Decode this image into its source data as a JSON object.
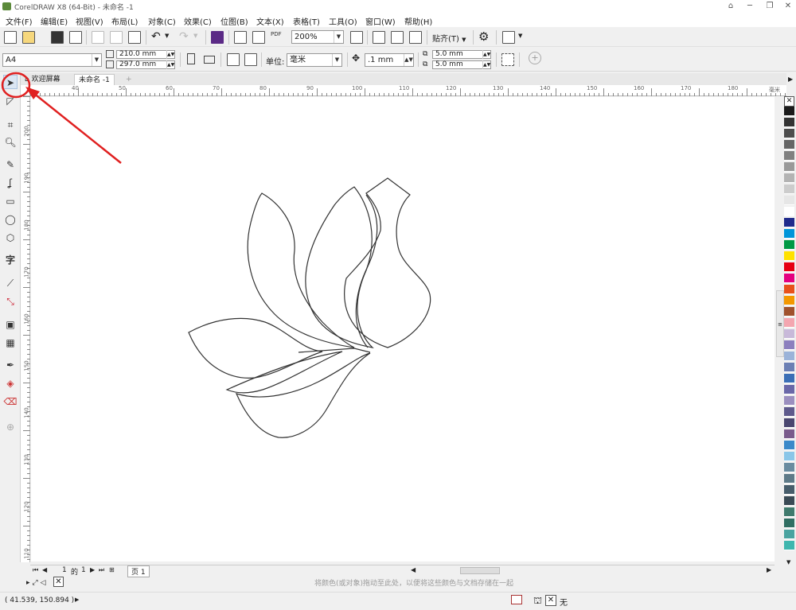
{
  "window": {
    "title": "CorelDRAW X8 (64-Bit) - 未命名 -1"
  },
  "menu": [
    "文件(F)",
    "编辑(E)",
    "视图(V)",
    "布局(L)",
    "对象(C)",
    "效果(C)",
    "位图(B)",
    "文本(X)",
    "表格(T)",
    "工具(O)",
    "窗口(W)",
    "帮助(H)"
  ],
  "toolbar": {
    "zoom": "200%",
    "snap_label": "贴齐(T)",
    "pdf_label": "PDF"
  },
  "property": {
    "page_size": "A4",
    "width": "210.0 mm",
    "height": "297.0 mm",
    "unit_label": "单位:",
    "unit_value": "毫米",
    "nudge": ".1 mm",
    "dup_x": "5.0 mm",
    "dup_y": "5.0 mm"
  },
  "tabs": {
    "welcome": "欢迎屏幕",
    "doc": "未命名 -1"
  },
  "ruler": {
    "h_labels": [
      "40",
      "50",
      "60",
      "70",
      "80",
      "90",
      "100",
      "110",
      "120",
      "130",
      "140",
      "150",
      "160",
      "170",
      "180"
    ],
    "unit": "毫米",
    "v_labels": [
      "200",
      "190",
      "180",
      "170",
      "160",
      "150",
      "140",
      "130",
      "120",
      "110"
    ]
  },
  "page_nav": {
    "current": "1",
    "of_label": "的",
    "total": "1",
    "page_tab": "页 1"
  },
  "status": {
    "coords": "( 41.539, 150.894 )",
    "hint": "将颜色(或对象)拖动至此处，以便将这些颜色与文档存储在一起",
    "fill_none": "无"
  },
  "palette": [
    "#1a1a1a",
    "#333333",
    "#4d4d4d",
    "#666666",
    "#808080",
    "#999999",
    "#b3b3b3",
    "#cccccc",
    "#e6e6e6",
    "#ffffff",
    "#1f2a8c",
    "#0095d9",
    "#009944",
    "#ffe100",
    "#e60012",
    "#e4007f",
    "#e8511b",
    "#f39800",
    "#a0522d",
    "#f4a6b0",
    "#c8b9d9",
    "#8c7fbe",
    "#9bb3d9",
    "#6b7fb4",
    "#3b6fb6",
    "#6a68a8",
    "#9b8fbf",
    "#5e5a8c",
    "#4a4770",
    "#7a5b8c",
    "#3b89c9",
    "#8ac6e8",
    "#6a8ca0",
    "#5e7a88",
    "#475d6b",
    "#3a4a55",
    "#3f7a6d",
    "#2f6e62",
    "#4aa3a0",
    "#3fb6ae"
  ],
  "colors": {
    "accent": "#e02020",
    "canvas": "#ffffff",
    "ui": "#f0f0f0"
  }
}
